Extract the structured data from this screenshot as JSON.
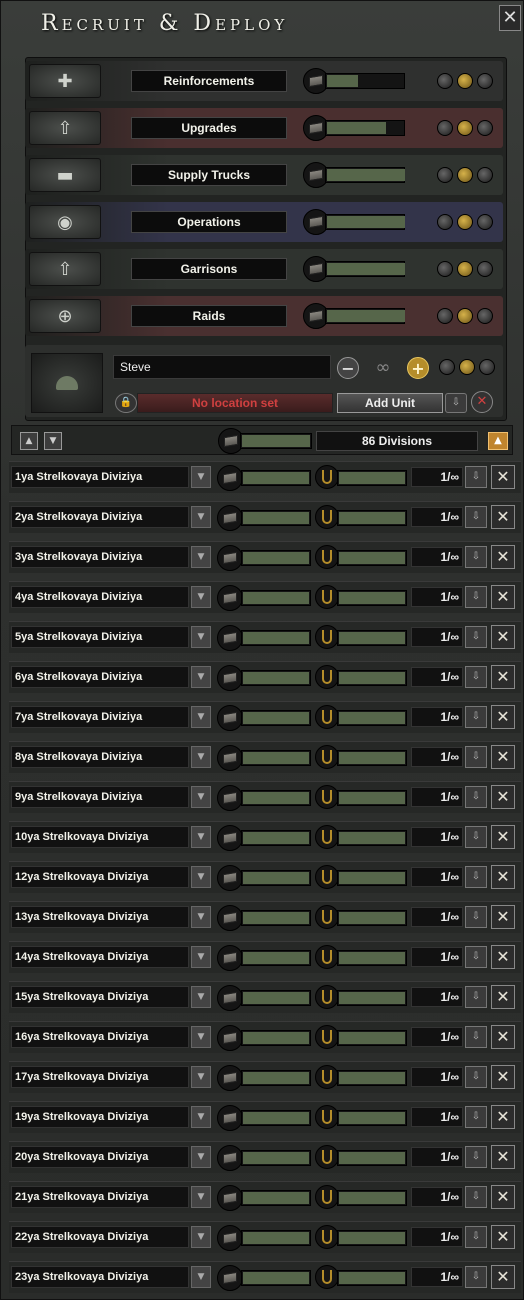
{
  "window": {
    "title": "Recruit & Deploy",
    "close_symbol": "✕"
  },
  "priorities": [
    {
      "label": "Reinforcements",
      "icon": "reinforce-icon",
      "tint": "#2f302f",
      "fill_pct": 40,
      "level": 2
    },
    {
      "label": "Upgrades",
      "icon": "upgrade-icon",
      "tint": "#4a2f2f",
      "fill_pct": 75,
      "level": 2
    },
    {
      "label": "Supply Trucks",
      "icon": "truck-icon",
      "tint": "#2f332f",
      "fill_pct": 100,
      "level": 2
    },
    {
      "label": "Operations",
      "icon": "eye-icon",
      "tint": "#33344a",
      "fill_pct": 100,
      "level": 2
    },
    {
      "label": "Garrisons",
      "icon": "garrison-icon",
      "tint": "#2f332f",
      "fill_pct": 100,
      "level": 2
    },
    {
      "label": "Raids",
      "icon": "crosshair-icon",
      "tint": "#4a3030",
      "fill_pct": 100,
      "level": 2
    }
  ],
  "template": {
    "name": "Steve",
    "count": "∞",
    "location": "No location set",
    "add_label": "Add Unit"
  },
  "toolbar": {
    "division_count": "86 Divisions",
    "up": "▲",
    "down": "▼",
    "collapse": "▲"
  },
  "divisions": [
    {
      "name": "1ya Strelkovaya Diviziya",
      "ratio": "1/∞"
    },
    {
      "name": "2ya Strelkovaya Diviziya",
      "ratio": "1/∞"
    },
    {
      "name": "3ya Strelkovaya Diviziya",
      "ratio": "1/∞"
    },
    {
      "name": "4ya Strelkovaya Diviziya",
      "ratio": "1/∞"
    },
    {
      "name": "5ya Strelkovaya Diviziya",
      "ratio": "1/∞"
    },
    {
      "name": "6ya Strelkovaya Diviziya",
      "ratio": "1/∞"
    },
    {
      "name": "7ya Strelkovaya Diviziya",
      "ratio": "1/∞"
    },
    {
      "name": "8ya Strelkovaya Diviziya",
      "ratio": "1/∞"
    },
    {
      "name": "9ya Strelkovaya Diviziya",
      "ratio": "1/∞"
    },
    {
      "name": "10ya Strelkovaya Diviziya",
      "ratio": "1/∞"
    },
    {
      "name": "12ya Strelkovaya Diviziya",
      "ratio": "1/∞"
    },
    {
      "name": "13ya Strelkovaya Diviziya",
      "ratio": "1/∞"
    },
    {
      "name": "14ya Strelkovaya Diviziya",
      "ratio": "1/∞"
    },
    {
      "name": "15ya Strelkovaya Diviziya",
      "ratio": "1/∞"
    },
    {
      "name": "16ya Strelkovaya Diviziya",
      "ratio": "1/∞"
    },
    {
      "name": "17ya Strelkovaya Diviziya",
      "ratio": "1/∞"
    },
    {
      "name": "19ya Strelkovaya Diviziya",
      "ratio": "1/∞"
    },
    {
      "name": "20ya Strelkovaya Diviziya",
      "ratio": "1/∞"
    },
    {
      "name": "21ya Strelkovaya Diviziya",
      "ratio": "1/∞"
    },
    {
      "name": "22ya Strelkovaya Diviziya",
      "ratio": "1/∞"
    },
    {
      "name": "23ya Strelkovaya Diviziya",
      "ratio": "1/∞"
    }
  ]
}
